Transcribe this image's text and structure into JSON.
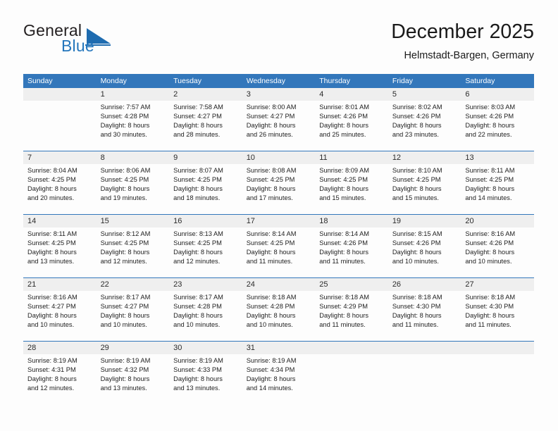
{
  "brand": {
    "word1": "General",
    "word2": "Blue",
    "logo_icon": "blue-triangle-icon",
    "accent_color": "#1f6cb0"
  },
  "header": {
    "month_title": "December 2025",
    "location": "Helmstadt-Bargen, Germany"
  },
  "theme": {
    "header_row_bg": "#3377bb",
    "daynum_bg": "#efefef",
    "page_bg": "#fdfdfd",
    "text": "#222222"
  },
  "weekday_headers": [
    "Sunday",
    "Monday",
    "Tuesday",
    "Wednesday",
    "Thursday",
    "Friday",
    "Saturday"
  ],
  "weeks": [
    [
      {
        "day": "",
        "lines": []
      },
      {
        "day": "1",
        "lines": [
          "Sunrise: 7:57 AM",
          "Sunset: 4:28 PM",
          "Daylight: 8 hours",
          "and 30 minutes."
        ]
      },
      {
        "day": "2",
        "lines": [
          "Sunrise: 7:58 AM",
          "Sunset: 4:27 PM",
          "Daylight: 8 hours",
          "and 28 minutes."
        ]
      },
      {
        "day": "3",
        "lines": [
          "Sunrise: 8:00 AM",
          "Sunset: 4:27 PM",
          "Daylight: 8 hours",
          "and 26 minutes."
        ]
      },
      {
        "day": "4",
        "lines": [
          "Sunrise: 8:01 AM",
          "Sunset: 4:26 PM",
          "Daylight: 8 hours",
          "and 25 minutes."
        ]
      },
      {
        "day": "5",
        "lines": [
          "Sunrise: 8:02 AM",
          "Sunset: 4:26 PM",
          "Daylight: 8 hours",
          "and 23 minutes."
        ]
      },
      {
        "day": "6",
        "lines": [
          "Sunrise: 8:03 AM",
          "Sunset: 4:26 PM",
          "Daylight: 8 hours",
          "and 22 minutes."
        ]
      }
    ],
    [
      {
        "day": "7",
        "lines": [
          "Sunrise: 8:04 AM",
          "Sunset: 4:25 PM",
          "Daylight: 8 hours",
          "and 20 minutes."
        ]
      },
      {
        "day": "8",
        "lines": [
          "Sunrise: 8:06 AM",
          "Sunset: 4:25 PM",
          "Daylight: 8 hours",
          "and 19 minutes."
        ]
      },
      {
        "day": "9",
        "lines": [
          "Sunrise: 8:07 AM",
          "Sunset: 4:25 PM",
          "Daylight: 8 hours",
          "and 18 minutes."
        ]
      },
      {
        "day": "10",
        "lines": [
          "Sunrise: 8:08 AM",
          "Sunset: 4:25 PM",
          "Daylight: 8 hours",
          "and 17 minutes."
        ]
      },
      {
        "day": "11",
        "lines": [
          "Sunrise: 8:09 AM",
          "Sunset: 4:25 PM",
          "Daylight: 8 hours",
          "and 15 minutes."
        ]
      },
      {
        "day": "12",
        "lines": [
          "Sunrise: 8:10 AM",
          "Sunset: 4:25 PM",
          "Daylight: 8 hours",
          "and 15 minutes."
        ]
      },
      {
        "day": "13",
        "lines": [
          "Sunrise: 8:11 AM",
          "Sunset: 4:25 PM",
          "Daylight: 8 hours",
          "and 14 minutes."
        ]
      }
    ],
    [
      {
        "day": "14",
        "lines": [
          "Sunrise: 8:11 AM",
          "Sunset: 4:25 PM",
          "Daylight: 8 hours",
          "and 13 minutes."
        ]
      },
      {
        "day": "15",
        "lines": [
          "Sunrise: 8:12 AM",
          "Sunset: 4:25 PM",
          "Daylight: 8 hours",
          "and 12 minutes."
        ]
      },
      {
        "day": "16",
        "lines": [
          "Sunrise: 8:13 AM",
          "Sunset: 4:25 PM",
          "Daylight: 8 hours",
          "and 12 minutes."
        ]
      },
      {
        "day": "17",
        "lines": [
          "Sunrise: 8:14 AM",
          "Sunset: 4:25 PM",
          "Daylight: 8 hours",
          "and 11 minutes."
        ]
      },
      {
        "day": "18",
        "lines": [
          "Sunrise: 8:14 AM",
          "Sunset: 4:26 PM",
          "Daylight: 8 hours",
          "and 11 minutes."
        ]
      },
      {
        "day": "19",
        "lines": [
          "Sunrise: 8:15 AM",
          "Sunset: 4:26 PM",
          "Daylight: 8 hours",
          "and 10 minutes."
        ]
      },
      {
        "day": "20",
        "lines": [
          "Sunrise: 8:16 AM",
          "Sunset: 4:26 PM",
          "Daylight: 8 hours",
          "and 10 minutes."
        ]
      }
    ],
    [
      {
        "day": "21",
        "lines": [
          "Sunrise: 8:16 AM",
          "Sunset: 4:27 PM",
          "Daylight: 8 hours",
          "and 10 minutes."
        ]
      },
      {
        "day": "22",
        "lines": [
          "Sunrise: 8:17 AM",
          "Sunset: 4:27 PM",
          "Daylight: 8 hours",
          "and 10 minutes."
        ]
      },
      {
        "day": "23",
        "lines": [
          "Sunrise: 8:17 AM",
          "Sunset: 4:28 PM",
          "Daylight: 8 hours",
          "and 10 minutes."
        ]
      },
      {
        "day": "24",
        "lines": [
          "Sunrise: 8:18 AM",
          "Sunset: 4:28 PM",
          "Daylight: 8 hours",
          "and 10 minutes."
        ]
      },
      {
        "day": "25",
        "lines": [
          "Sunrise: 8:18 AM",
          "Sunset: 4:29 PM",
          "Daylight: 8 hours",
          "and 11 minutes."
        ]
      },
      {
        "day": "26",
        "lines": [
          "Sunrise: 8:18 AM",
          "Sunset: 4:30 PM",
          "Daylight: 8 hours",
          "and 11 minutes."
        ]
      },
      {
        "day": "27",
        "lines": [
          "Sunrise: 8:18 AM",
          "Sunset: 4:30 PM",
          "Daylight: 8 hours",
          "and 11 minutes."
        ]
      }
    ],
    [
      {
        "day": "28",
        "lines": [
          "Sunrise: 8:19 AM",
          "Sunset: 4:31 PM",
          "Daylight: 8 hours",
          "and 12 minutes."
        ]
      },
      {
        "day": "29",
        "lines": [
          "Sunrise: 8:19 AM",
          "Sunset: 4:32 PM",
          "Daylight: 8 hours",
          "and 13 minutes."
        ]
      },
      {
        "day": "30",
        "lines": [
          "Sunrise: 8:19 AM",
          "Sunset: 4:33 PM",
          "Daylight: 8 hours",
          "and 13 minutes."
        ]
      },
      {
        "day": "31",
        "lines": [
          "Sunrise: 8:19 AM",
          "Sunset: 4:34 PM",
          "Daylight: 8 hours",
          "and 14 minutes."
        ]
      },
      {
        "day": "",
        "lines": []
      },
      {
        "day": "",
        "lines": []
      },
      {
        "day": "",
        "lines": []
      }
    ]
  ]
}
